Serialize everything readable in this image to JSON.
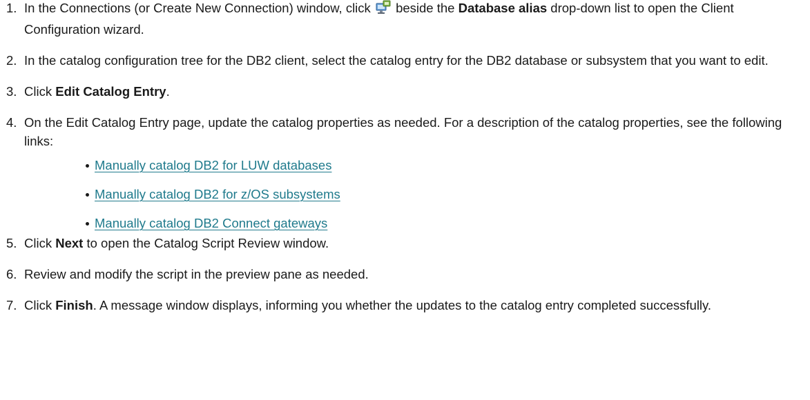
{
  "steps": [
    {
      "num": "1.",
      "pre": "In the Connections (or Create New Connection) window, click",
      "icon": "client-configuration-icon",
      "mid": "beside the",
      "bold": "Database alias",
      "post": "drop-down list to open the Client Configuration wizard."
    },
    {
      "num": "2.",
      "text": "In the catalog configuration tree for the DB2 client, select the catalog entry for the DB2 database or subsystem that you want to edit."
    },
    {
      "num": "3.",
      "pre": "Click",
      "bold": "Edit Catalog Entry",
      "post": "."
    },
    {
      "num": "4.",
      "text": "On the Edit Catalog Entry page, update the catalog properties as needed. For a description of the catalog properties, see the following links:",
      "links": [
        "Manually catalog DB2 for LUW databases",
        "Manually catalog DB2 for z/OS subsystems",
        "Manually catalog DB2 Connect gateways"
      ]
    },
    {
      "num": "5.",
      "pre": "Click",
      "bold": "Next",
      "post": "to open the Catalog Script Review window."
    },
    {
      "num": "6.",
      "text": "Review and modify the script in the preview pane as needed."
    },
    {
      "num": "7.",
      "pre": "Click",
      "bold": "Finish",
      "post": ". A message window displays, informing you whether the updates to the catalog entry completed successfully."
    }
  ]
}
